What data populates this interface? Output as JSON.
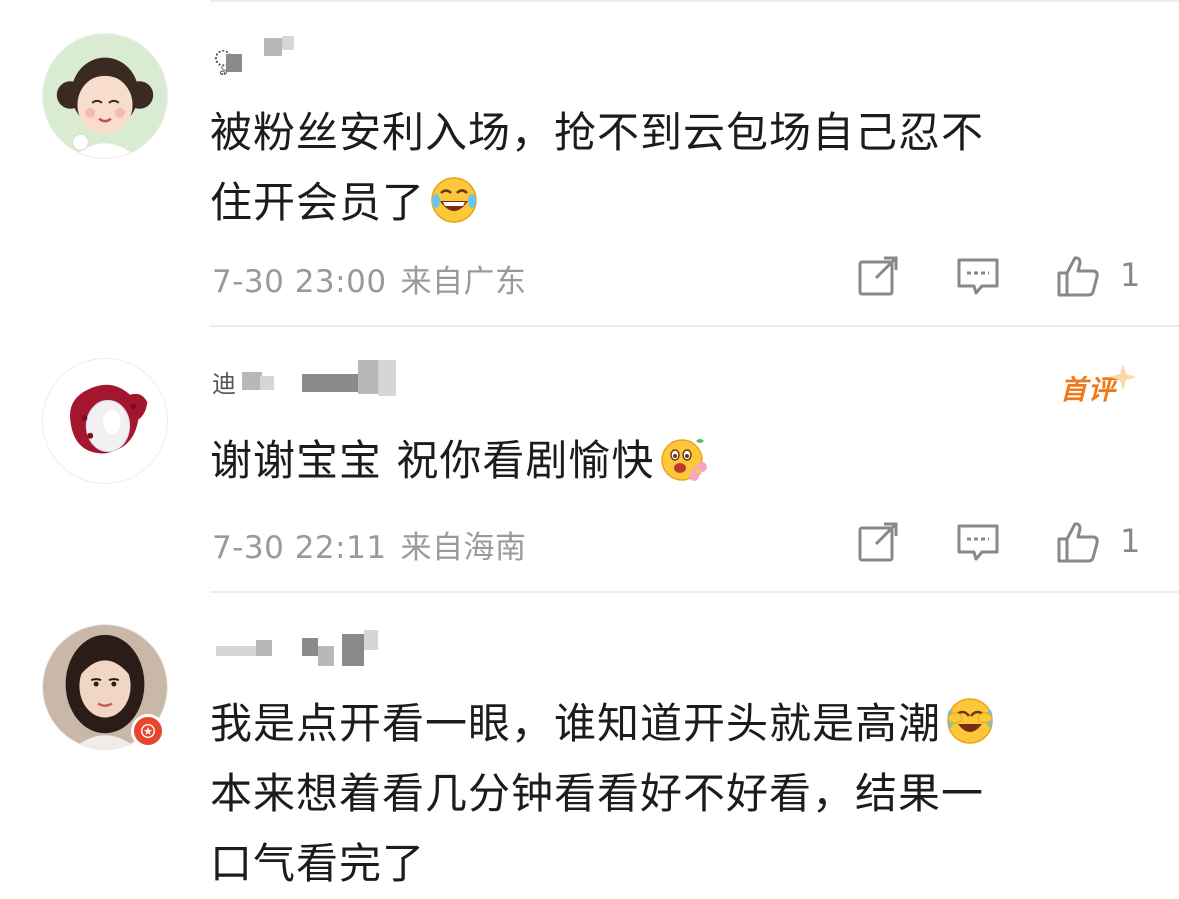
{
  "comments": [
    {
      "username": "ৢ",
      "content_line1": "被粉丝安利入场，抢不到云包场自己忍不",
      "content_line2": "住开会员了",
      "emoji": "laugh-tears-emoji",
      "time": "7-30 23:00",
      "location": "来自广东",
      "like_count": "1"
    },
    {
      "username": "迪",
      "tag": "首评",
      "content_line1": "谢谢宝宝 祝你看剧愉快",
      "emoji": "flower-happy-emoji",
      "time": "7-30 22:11",
      "location": "来自海南",
      "like_count": "1"
    },
    {
      "username": "",
      "content_line1": "我是点开看一眼，谁知道开头就是高潮",
      "emoji": "laugh-cry-emoji",
      "content_line2": "本来想着看几分钟看看好不好看，结果一",
      "content_line3": "口气看完了"
    }
  ],
  "icons": {
    "share": "share-edit-icon",
    "comment": "comment-bubble-icon",
    "like": "thumbs-up-icon",
    "badge": "red-star-verified-badge"
  },
  "colors": {
    "meta_text": "#9a9a9a",
    "first_tag": "#f07a1b",
    "badge": "#e8452c"
  }
}
